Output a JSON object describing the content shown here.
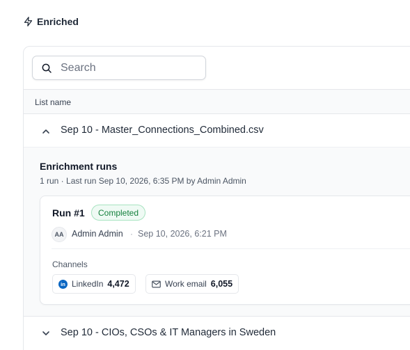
{
  "header": {
    "title": "Enriched",
    "icon": "bolt-icon"
  },
  "search": {
    "placeholder": "Search"
  },
  "table": {
    "column_header": "List name"
  },
  "lists": [
    {
      "name": "Sep 10 - Master_Connections_Combined.csv",
      "expanded": true,
      "enrichment": {
        "title": "Enrichment runs",
        "summary": "1 run · Last run Sep 10, 2026, 6:35 PM by Admin Admin",
        "runs": [
          {
            "title": "Run #1",
            "status": "Completed",
            "avatar_initials": "AA",
            "user": "Admin Admin",
            "separator": "·",
            "date": "Sep 10, 2026, 6:21 PM",
            "channels_label": "Channels",
            "channels": [
              {
                "name": "LinkedIn",
                "count": "4,472",
                "icon": "linkedin-icon",
                "icon_text": "in"
              },
              {
                "name": "Work email",
                "count": "6,055",
                "icon": "mail-icon"
              }
            ]
          }
        ]
      }
    },
    {
      "name": "Sep 10 - CIOs, CSOs & IT Managers in Sweden",
      "expanded": false
    }
  ],
  "colors": {
    "status_green": "#15803d",
    "status_bg": "#effaf4",
    "linkedin_blue": "#0a66c2"
  }
}
